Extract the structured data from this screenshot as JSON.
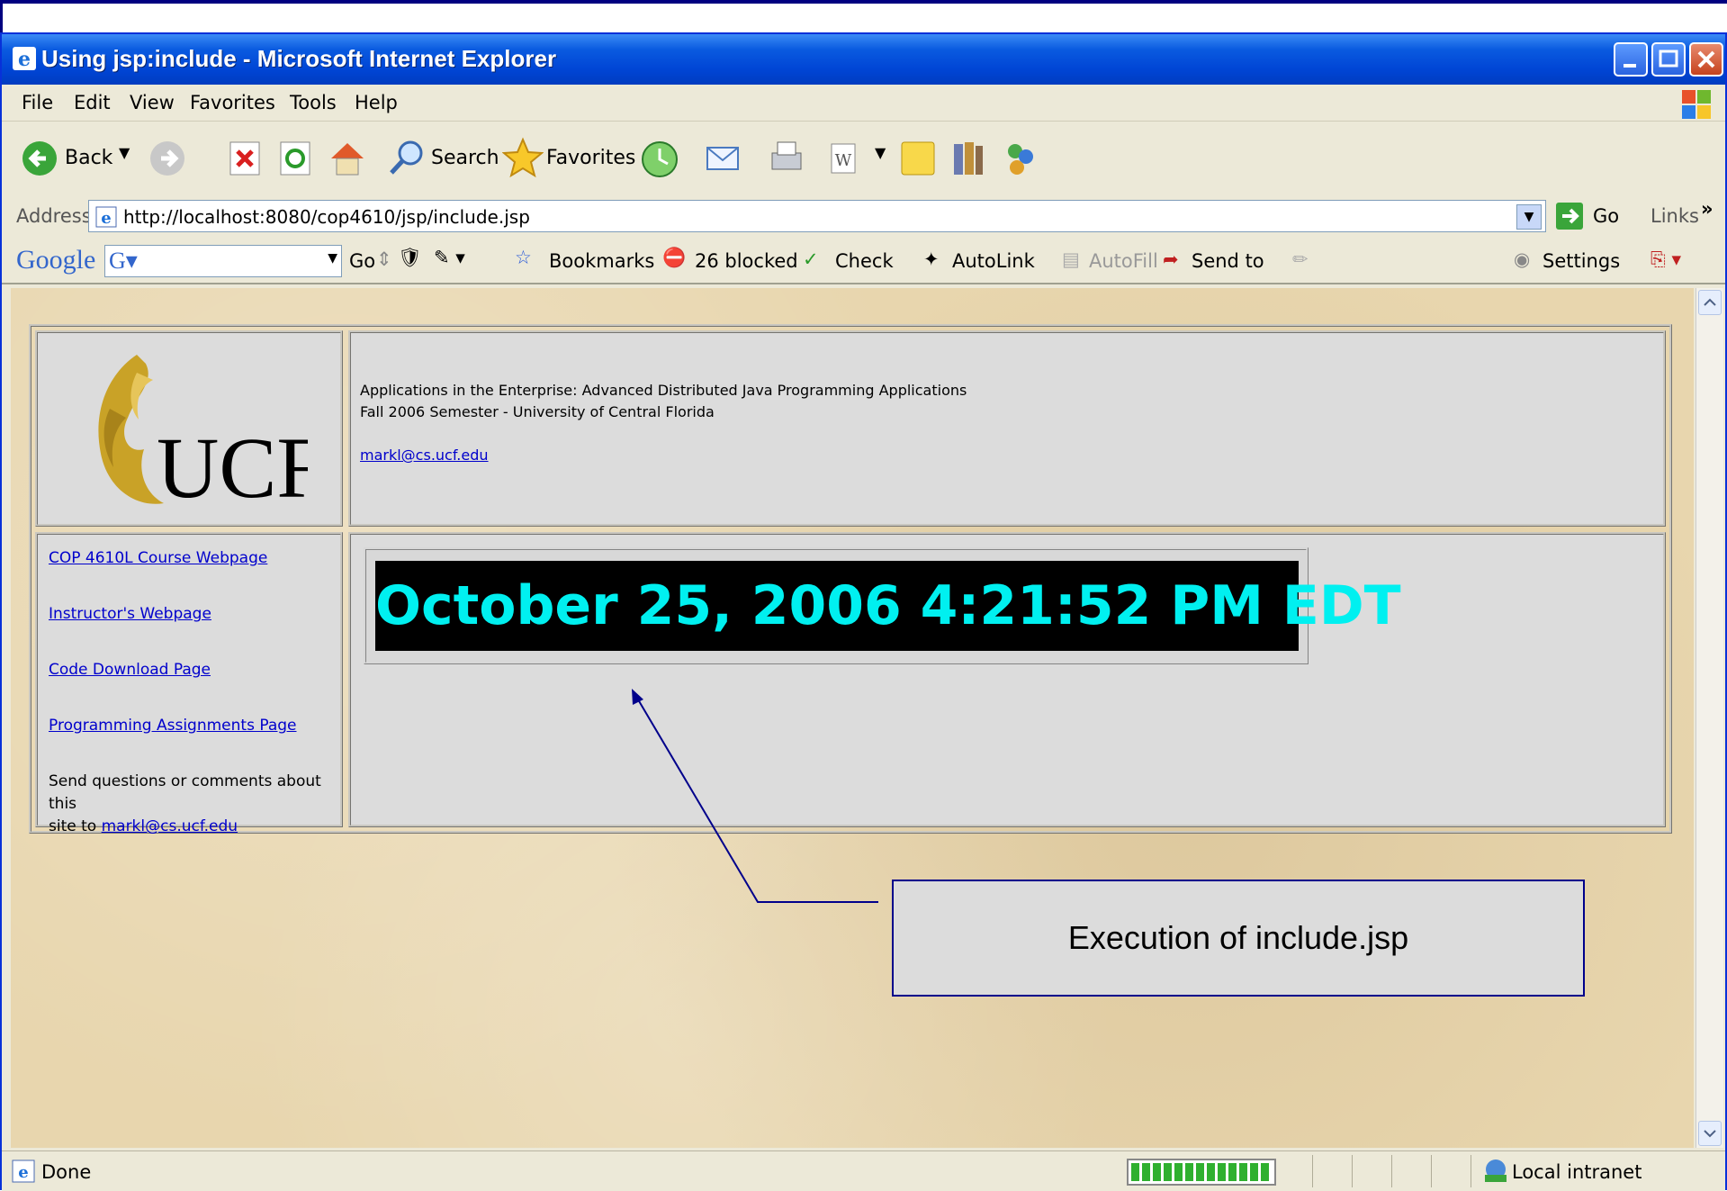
{
  "window": {
    "title": "Using jsp:include - Microsoft Internet Explorer"
  },
  "menu": [
    "File",
    "Edit",
    "View",
    "Favorites",
    "Tools",
    "Help"
  ],
  "toolbar": {
    "back": "Back",
    "search": "Search",
    "favorites": "Favorites"
  },
  "address": {
    "label": "Address",
    "url": "http://localhost:8080/cop4610/jsp/include.jsp",
    "go": "Go",
    "links": "Links"
  },
  "google": {
    "logo": "Google",
    "go": "Go",
    "bookmarks": "Bookmarks",
    "blocked": "26 blocked",
    "check": "Check",
    "autolink": "AutoLink",
    "autofill": "AutoFill",
    "sendto": "Send to",
    "settings": "Settings"
  },
  "page": {
    "logo_text": "UCF",
    "header_line1": "Applications in the Enterprise: Advanced Distributed Java Programming Applications",
    "header_line2": "Fall 2006 Semester - University of Central Florida",
    "header_email": "markl@cs.ucf.edu",
    "links": [
      "COP 4610L Course Webpage",
      "Instructor's Webpage",
      "Code Download Page",
      "Programming Assignments Page"
    ],
    "contact_text_1": "Send questions or comments about this",
    "contact_text_2": "site to",
    "contact_email": "markl@cs.ucf.edu",
    "clock": "October 25, 2006 4:21:52 PM EDT"
  },
  "callout": {
    "text": "Execution of include.jsp"
  },
  "status": {
    "left": "Done",
    "zone": "Local intranet"
  },
  "colors": {
    "titlebar": "#0a5be0",
    "clock_text": "#00f0f0",
    "link": "#0000cc",
    "callout_border": "#00008b"
  }
}
